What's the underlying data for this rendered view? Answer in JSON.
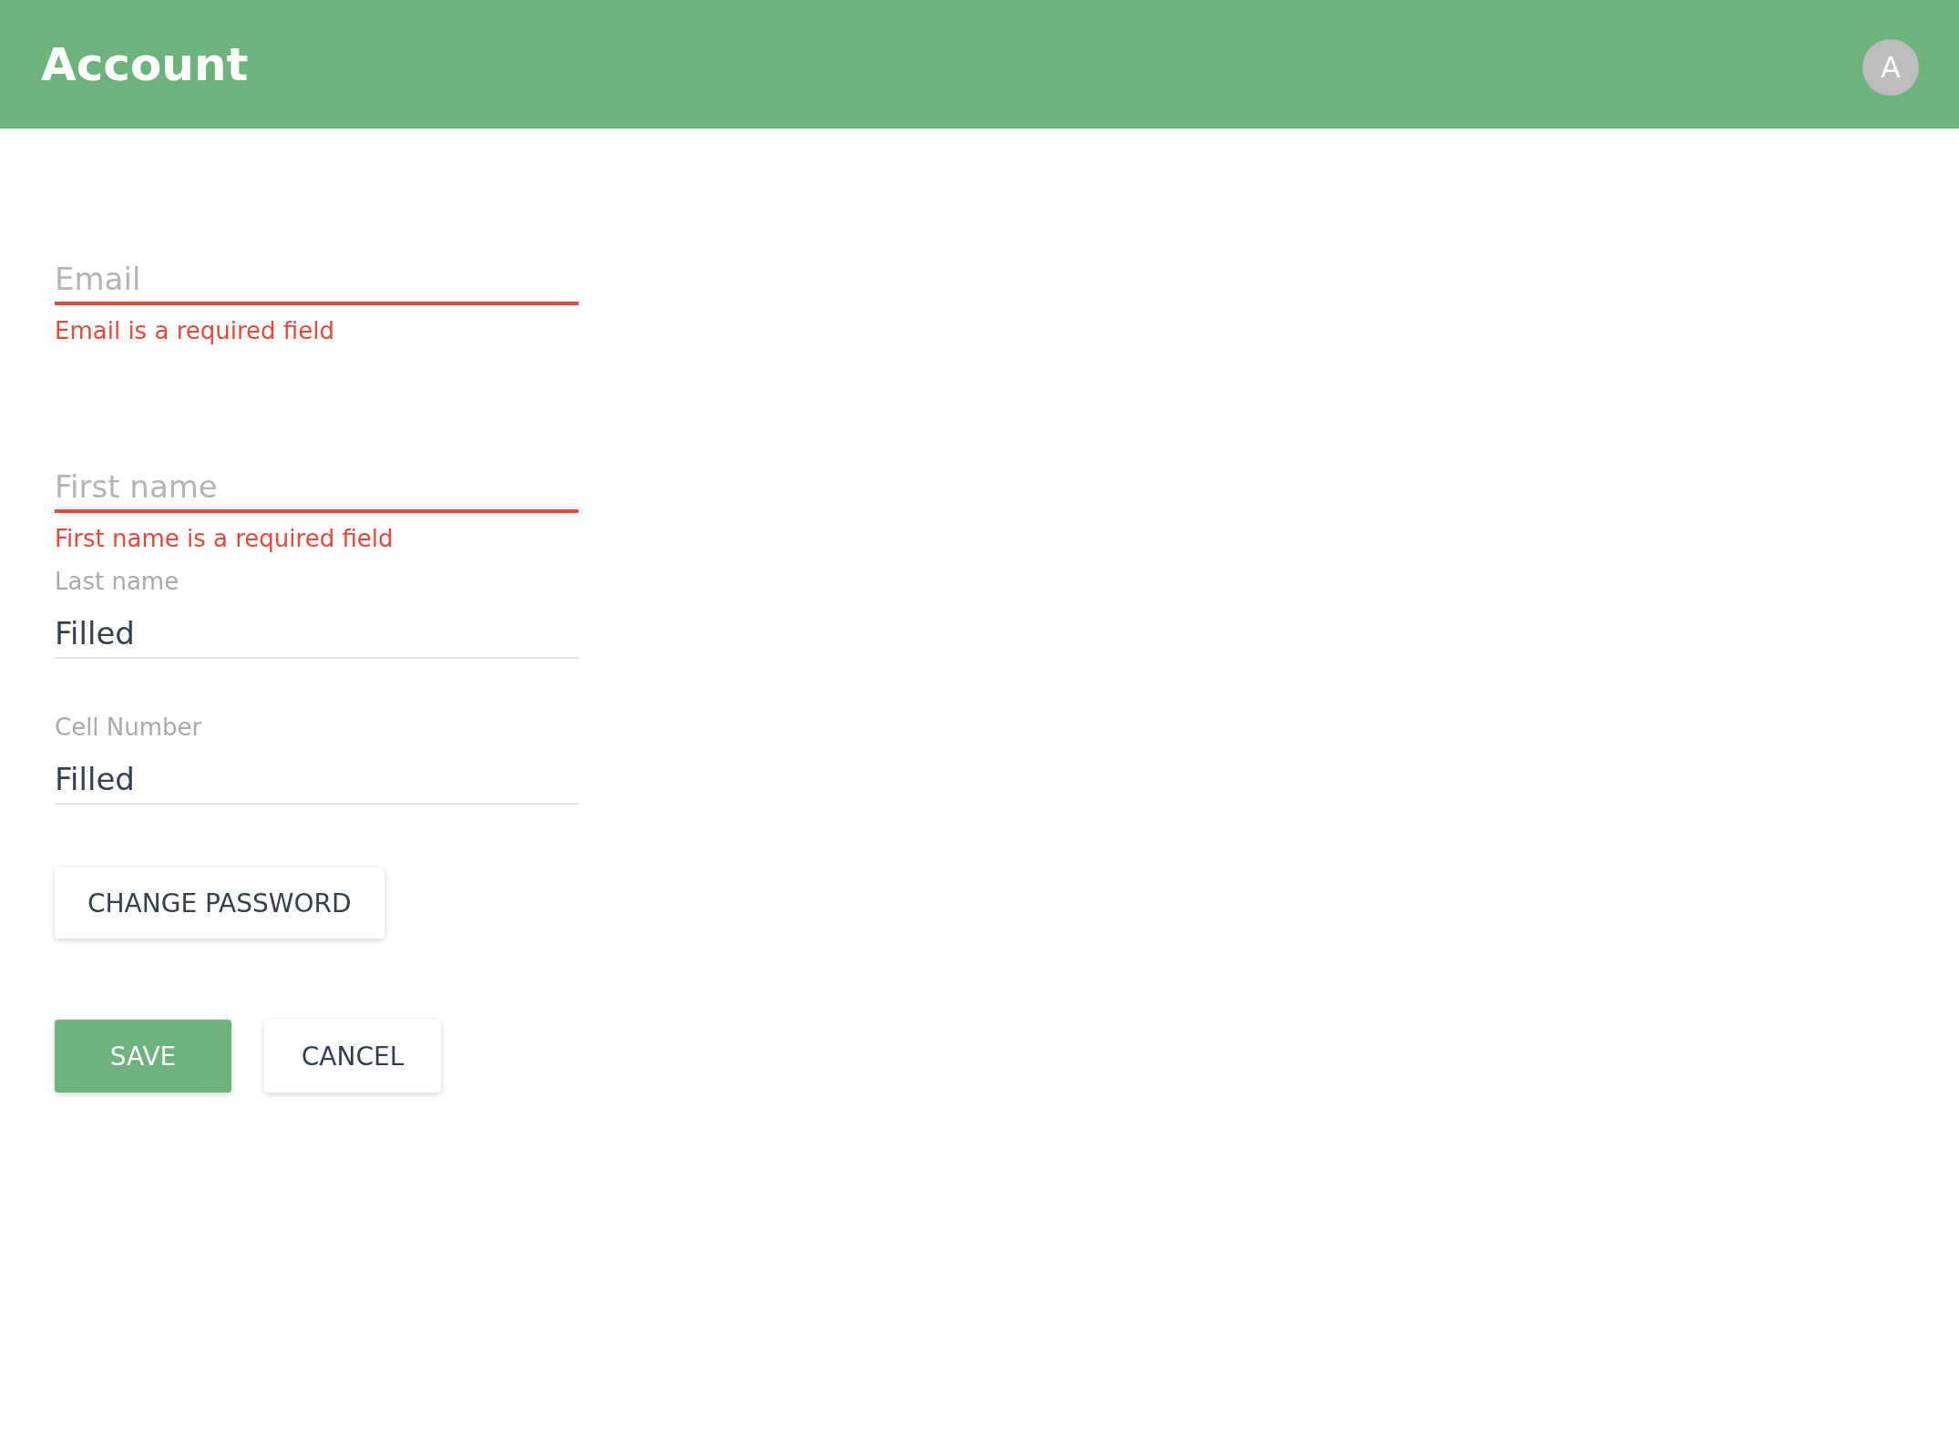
{
  "header": {
    "title": "Account",
    "avatar": "A"
  },
  "fields": [
    {
      "placeholder": "Email",
      "invalid": true,
      "error": "Email is a required field"
    },
    {
      "placeholder": "First name",
      "invalid": true,
      "error": "First name is a required field"
    },
    {
      "label": "Last name",
      "value": "Filled",
      "invalid": false
    },
    {
      "label": "Cell Number",
      "value": "Filled",
      "invalid": false
    }
  ],
  "change_password_button": "CHANGE PASSWORD",
  "actions": [
    {
      "label": "SAVE",
      "kind": "primary"
    },
    {
      "label": "CANCEL",
      "kind": "secondary"
    }
  ]
}
